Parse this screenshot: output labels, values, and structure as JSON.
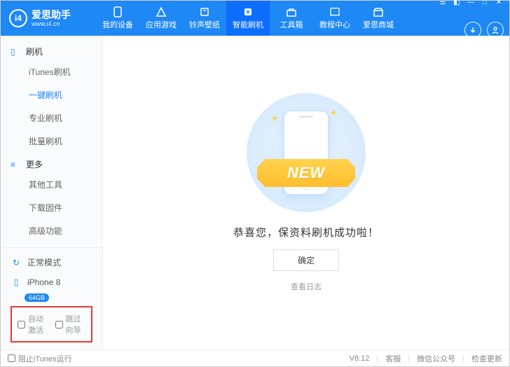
{
  "header": {
    "brand": "爱思助手",
    "url": "www.i4.cn",
    "logo_letters": "i4",
    "nav": [
      {
        "label": "我的设备",
        "icon": "device"
      },
      {
        "label": "应用游戏",
        "icon": "apps"
      },
      {
        "label": "铃声壁纸",
        "icon": "music"
      },
      {
        "label": "智能刷机",
        "icon": "flash",
        "active": true
      },
      {
        "label": "工具箱",
        "icon": "toolbox"
      },
      {
        "label": "教程中心",
        "icon": "book"
      },
      {
        "label": "爱思商城",
        "icon": "store"
      }
    ]
  },
  "sidebar": {
    "groups": [
      {
        "title": "刷机",
        "icon": "device",
        "items": [
          "iTunes刷机",
          "一键刷机",
          "专业刷机",
          "批量刷机"
        ],
        "active_index": 1
      },
      {
        "title": "更多",
        "icon": "more",
        "items": [
          "其他工具",
          "下载固件",
          "高级功能"
        ],
        "active_index": -1
      }
    ],
    "mode": "正常模式",
    "device_name": "iPhone 8",
    "device_badge": "64GB",
    "options": {
      "auto_activate": "自动激活",
      "skip_guide": "跳过向导"
    }
  },
  "main": {
    "ribbon": "NEW",
    "success": "恭喜您，保资料刷机成功啦！",
    "ok": "确定",
    "view_log": "查看日志"
  },
  "footer": {
    "block_itunes": "阻止iTunes运行",
    "version": "V8.12",
    "links": [
      "客服",
      "微信公众号",
      "检查更新"
    ]
  }
}
